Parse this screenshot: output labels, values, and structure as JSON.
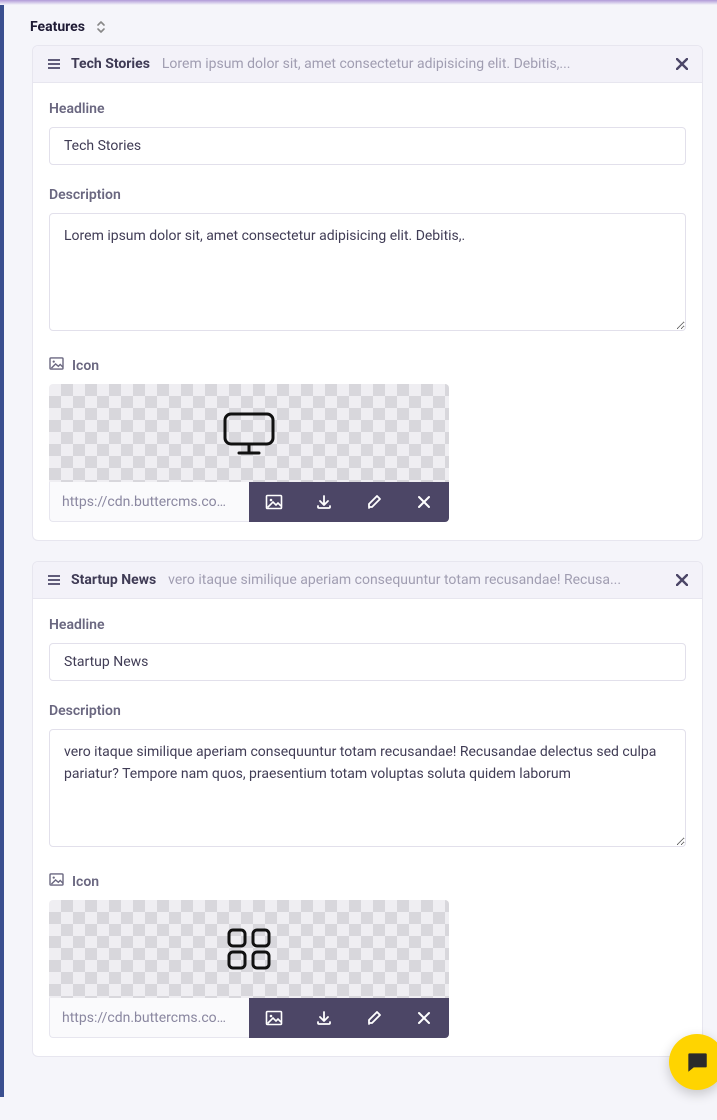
{
  "section_title": "Features",
  "labels": {
    "headline": "Headline",
    "description": "Description",
    "icon": "Icon"
  },
  "items": [
    {
      "title": "Tech Stories",
      "summary": "Lorem ipsum dolor sit, amet consectetur adipisicing elit. Debitis,...",
      "headline": "Tech Stories",
      "description": "Lorem ipsum dolor sit, amet consectetur adipisicing elit. Debitis,.",
      "icon_url": "https://cdn.buttercms.com/R1b",
      "icon_kind": "monitor"
    },
    {
      "title": "Startup News",
      "summary": "vero itaque similique aperiam consequuntur totam recusandae! Recusa...",
      "headline": "Startup News",
      "description": "vero itaque similique aperiam consequuntur totam recusandae! Recusandae delectus sed culpa pariatur? Tempore nam quos, praesentium totam voluptas soluta quidem laborum",
      "icon_url": "https://cdn.buttercms.com/KCl",
      "icon_kind": "grid"
    }
  ]
}
